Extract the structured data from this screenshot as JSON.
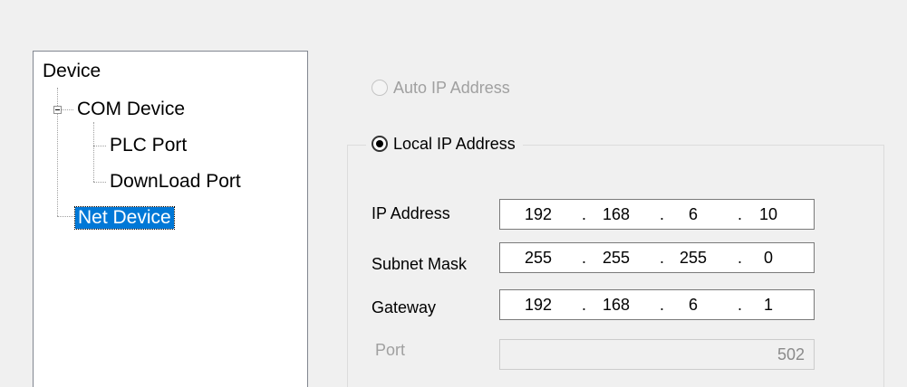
{
  "tree": {
    "root": "Device",
    "com_device": "COM Device",
    "plc_port": "PLC Port",
    "download_port": "DownLoad Port",
    "net_device": "Net Device"
  },
  "network": {
    "auto_ip_label": "Auto IP Address",
    "local_ip_label": "Local IP Address",
    "selected_mode": "Local IP Address",
    "fields": {
      "ip_address": {
        "label": "IP Address",
        "octets": [
          "192",
          "168",
          "6",
          "10"
        ]
      },
      "subnet_mask": {
        "label": "Subnet Mask",
        "octets": [
          "255",
          "255",
          "255",
          "0"
        ]
      },
      "gateway": {
        "label": "Gateway",
        "octets": [
          "192",
          "168",
          "6",
          "1"
        ]
      }
    },
    "port": {
      "label": "Port",
      "value": "502"
    },
    "separator": "."
  },
  "colors": {
    "selection": "#0078d7",
    "disabled_text": "#a0a0a0"
  }
}
